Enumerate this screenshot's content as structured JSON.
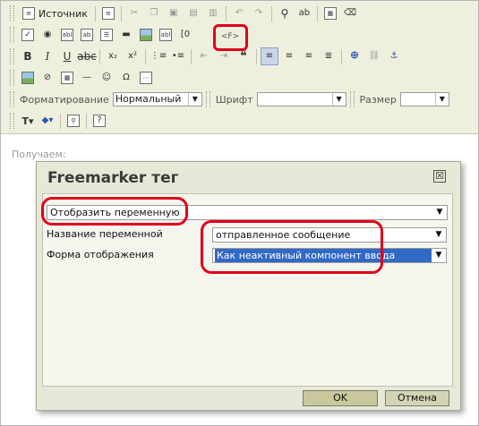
{
  "toolbar": {
    "source_label": "Источник",
    "formatting_label": "Форматирование",
    "formatting_value": "Нормальный",
    "font_label": "Шрифт",
    "font_value": "",
    "size_label": "Размер",
    "size_value": "",
    "freemarker_button_icon": "<F>",
    "icons_row1": [
      "source-icon",
      "newpage-icon",
      "cut-icon",
      "copy-icon",
      "paste-icon",
      "paste-text-icon",
      "paste-word-icon",
      "undo-icon",
      "redo-icon",
      "find-icon",
      "replace-icon",
      "select-all-icon",
      "remove-format-icon"
    ],
    "icons_row2": [
      "checkbox-icon",
      "radio-icon",
      "text-field-icon",
      "textarea-icon",
      "select-field-icon",
      "button-icon",
      "image-button-icon",
      "hidden-field-icon",
      "field-icon",
      "freemarker-icon"
    ],
    "icons_row3": [
      "bold-icon",
      "italic-icon",
      "underline-icon",
      "strike-icon",
      "subscript-icon",
      "superscript-icon",
      "numbered-list-icon",
      "bulleted-list-icon",
      "outdent-icon",
      "indent-icon",
      "blockquote-icon",
      "align-left-icon",
      "align-center-icon",
      "align-right-icon",
      "justify-icon",
      "link-icon",
      "unlink-icon",
      "anchor-icon"
    ],
    "icons_row4": [
      "image-icon",
      "flash-icon",
      "table-icon",
      "horizontal-rule-icon",
      "smiley-icon",
      "special-char-icon",
      "page-break-icon"
    ],
    "icons_row5": [
      "text-color-icon",
      "bg-color-icon",
      "maximize-icon",
      "help-icon"
    ]
  },
  "content": {
    "label": "Получаем:"
  },
  "dialog": {
    "title": "Freemarker тег",
    "close_symbol": "☒",
    "type_value": "Отобразить переменную",
    "var_name_label": "Название переменной",
    "var_name_value": "отправленное сообщение",
    "display_form_label": "Форма отображения",
    "display_form_value": "Как неактивный компонент ввода",
    "ok_label": "OK",
    "cancel_label": "Отмена"
  },
  "colors": {
    "toolbar_bg": "#efefde",
    "dialog_bg": "#e8e8d8",
    "highlight_red": "#e0001b",
    "selection_blue": "#3169c6"
  }
}
